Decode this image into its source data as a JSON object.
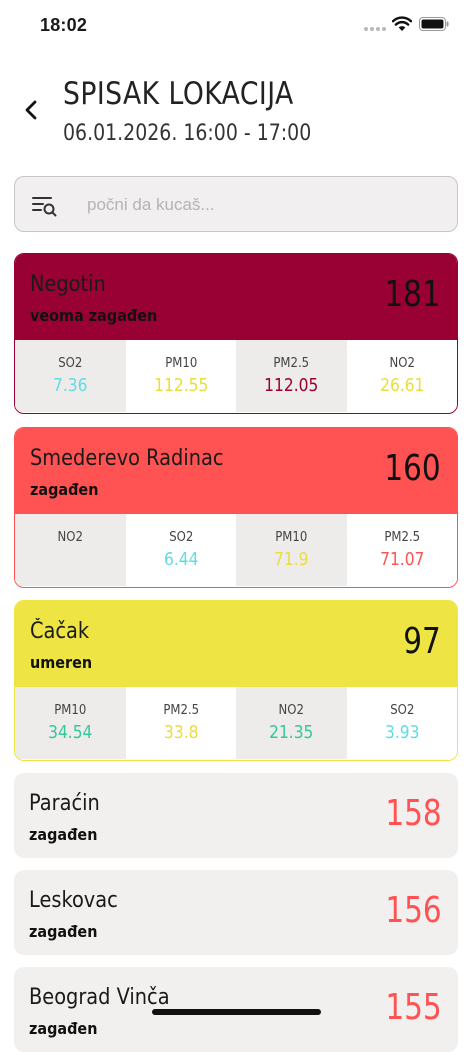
{
  "status_bar": {
    "time": "18:02"
  },
  "header": {
    "title": "SPISAK LOKACIJA",
    "subtitle": "06.01.2026. 16:00 - 17:00"
  },
  "search": {
    "placeholder": "počni da kucaš..."
  },
  "colors": {
    "very_polluted": "#990033",
    "polluted": "#ff5252",
    "moderate": "#eee544",
    "good_text": "#35c79e",
    "very_good_text": "#5fdde3",
    "neutral_card": "#f2efef"
  },
  "locations": [
    {
      "name": "Negotin",
      "status": "veoma zagađen",
      "value": "181",
      "pollutants": [
        {
          "name": "SO2",
          "value": "7.36"
        },
        {
          "name": "PM10",
          "value": "112.55"
        },
        {
          "name": "PM2.5",
          "value": "112.05"
        },
        {
          "name": "NO2",
          "value": "26.61"
        }
      ]
    },
    {
      "name": "Smederevo Radinac",
      "status": "zagađen",
      "value": "160",
      "pollutants": [
        {
          "name": "NO2",
          "value": ""
        },
        {
          "name": "SO2",
          "value": "6.44"
        },
        {
          "name": "PM10",
          "value": "71.9"
        },
        {
          "name": "PM2.5",
          "value": "71.07"
        }
      ]
    },
    {
      "name": "Čačak",
      "status": "umeren",
      "value": "97",
      "pollutants": [
        {
          "name": "PM10",
          "value": "34.54"
        },
        {
          "name": "PM2.5",
          "value": "33.8"
        },
        {
          "name": "NO2",
          "value": "21.35"
        },
        {
          "name": "SO2",
          "value": "3.93"
        }
      ]
    },
    {
      "name": "Paraćin",
      "status": "zagađen",
      "value": "158"
    },
    {
      "name": "Leskovac",
      "status": "zagađen",
      "value": "156"
    },
    {
      "name": "Beograd Vinča",
      "status": "zagađen",
      "value": "155"
    }
  ]
}
